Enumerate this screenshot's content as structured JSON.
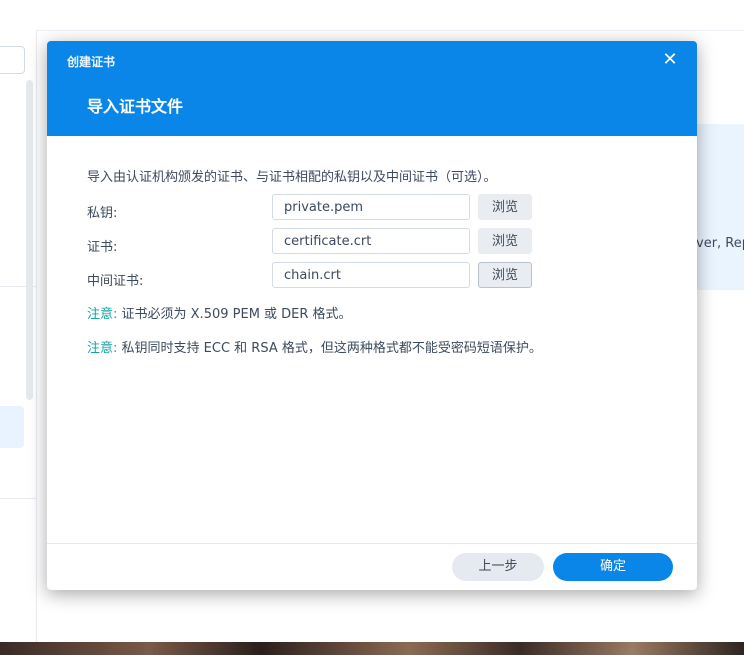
{
  "background": {
    "panel_text": "ver, Rep"
  },
  "dialog": {
    "small_title": "创建证书",
    "close_icon": "close-icon",
    "title": "导入证书文件",
    "description": "导入由认证机构颁发的证书、与证书相配的私钥以及中间证书（可选）。",
    "rows": [
      {
        "label": "私钥:",
        "value": "private.pem",
        "browse": "浏览"
      },
      {
        "label": "证书:",
        "value": "certificate.crt",
        "browse": "浏览"
      },
      {
        "label": "中间证书:",
        "value": "chain.crt",
        "browse": "浏览"
      }
    ],
    "notes": [
      {
        "label": "注意:",
        "text": " 证书必须为 X.509 PEM 或 DER 格式。"
      },
      {
        "label": "注意:",
        "text": " 私钥同时支持 ECC 和 RSA 格式，但这两种格式都不能受密码短语保护。"
      }
    ],
    "back_button": "上一步",
    "ok_button": "确定"
  },
  "colors": {
    "accent": "#0a86e8",
    "note": "#16a3a3"
  }
}
